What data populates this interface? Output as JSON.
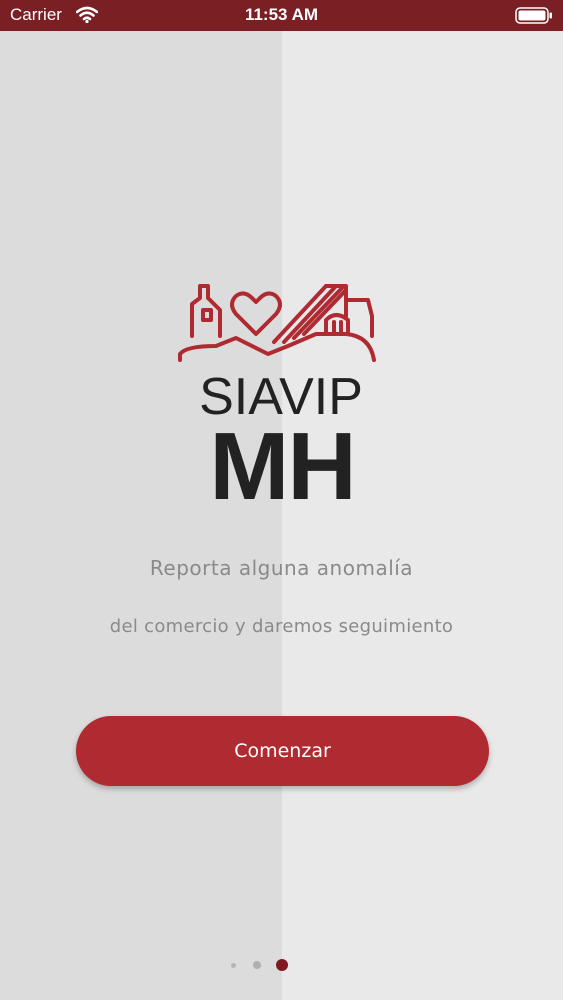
{
  "status_bar": {
    "carrier": "Carrier",
    "time": "11:53 AM",
    "wifi_icon": "wifi-icon",
    "battery_icon": "battery-icon"
  },
  "logo": {
    "line1": "SIAVIP",
    "line2": "MH",
    "emblem_icon": "house-heart-emblem-icon",
    "accent_color": "#b02a31"
  },
  "onboarding": {
    "line1": "Reporta alguna anomalía",
    "line2": "del comercio y daremos seguimiento",
    "button_label": "Comenzar"
  },
  "pagination": {
    "total": 3,
    "current": 3
  },
  "colors": {
    "status_bar": "#7a1f24",
    "button": "#b02a31",
    "active_dot": "#7e1b20"
  }
}
